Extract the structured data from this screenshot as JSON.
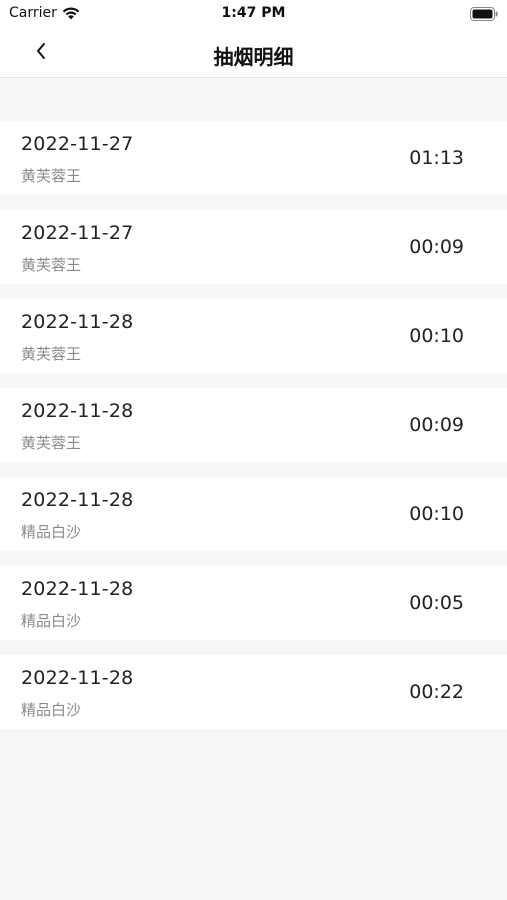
{
  "status_bar": {
    "carrier": "Carrier",
    "time": "1:47 PM"
  },
  "nav": {
    "title": "抽烟明细",
    "back_icon": "chevron-left-icon"
  },
  "records": [
    {
      "date": "2022-11-27",
      "brand": "黄芙蓉王",
      "duration": "01:13"
    },
    {
      "date": "2022-11-27",
      "brand": "黄芙蓉王",
      "duration": "00:09"
    },
    {
      "date": "2022-11-28",
      "brand": "黄芙蓉王",
      "duration": "00:10"
    },
    {
      "date": "2022-11-28",
      "brand": "黄芙蓉王",
      "duration": "00:09"
    },
    {
      "date": "2022-11-28",
      "brand": "精品白沙",
      "duration": "00:10"
    },
    {
      "date": "2022-11-28",
      "brand": "精品白沙",
      "duration": "00:05"
    },
    {
      "date": "2022-11-28",
      "brand": "精品白沙",
      "duration": "00:22"
    }
  ],
  "colors": {
    "background": "#f7f7f7",
    "card": "#ffffff",
    "primary_text": "#222222",
    "secondary_text": "#8a8a8a"
  }
}
